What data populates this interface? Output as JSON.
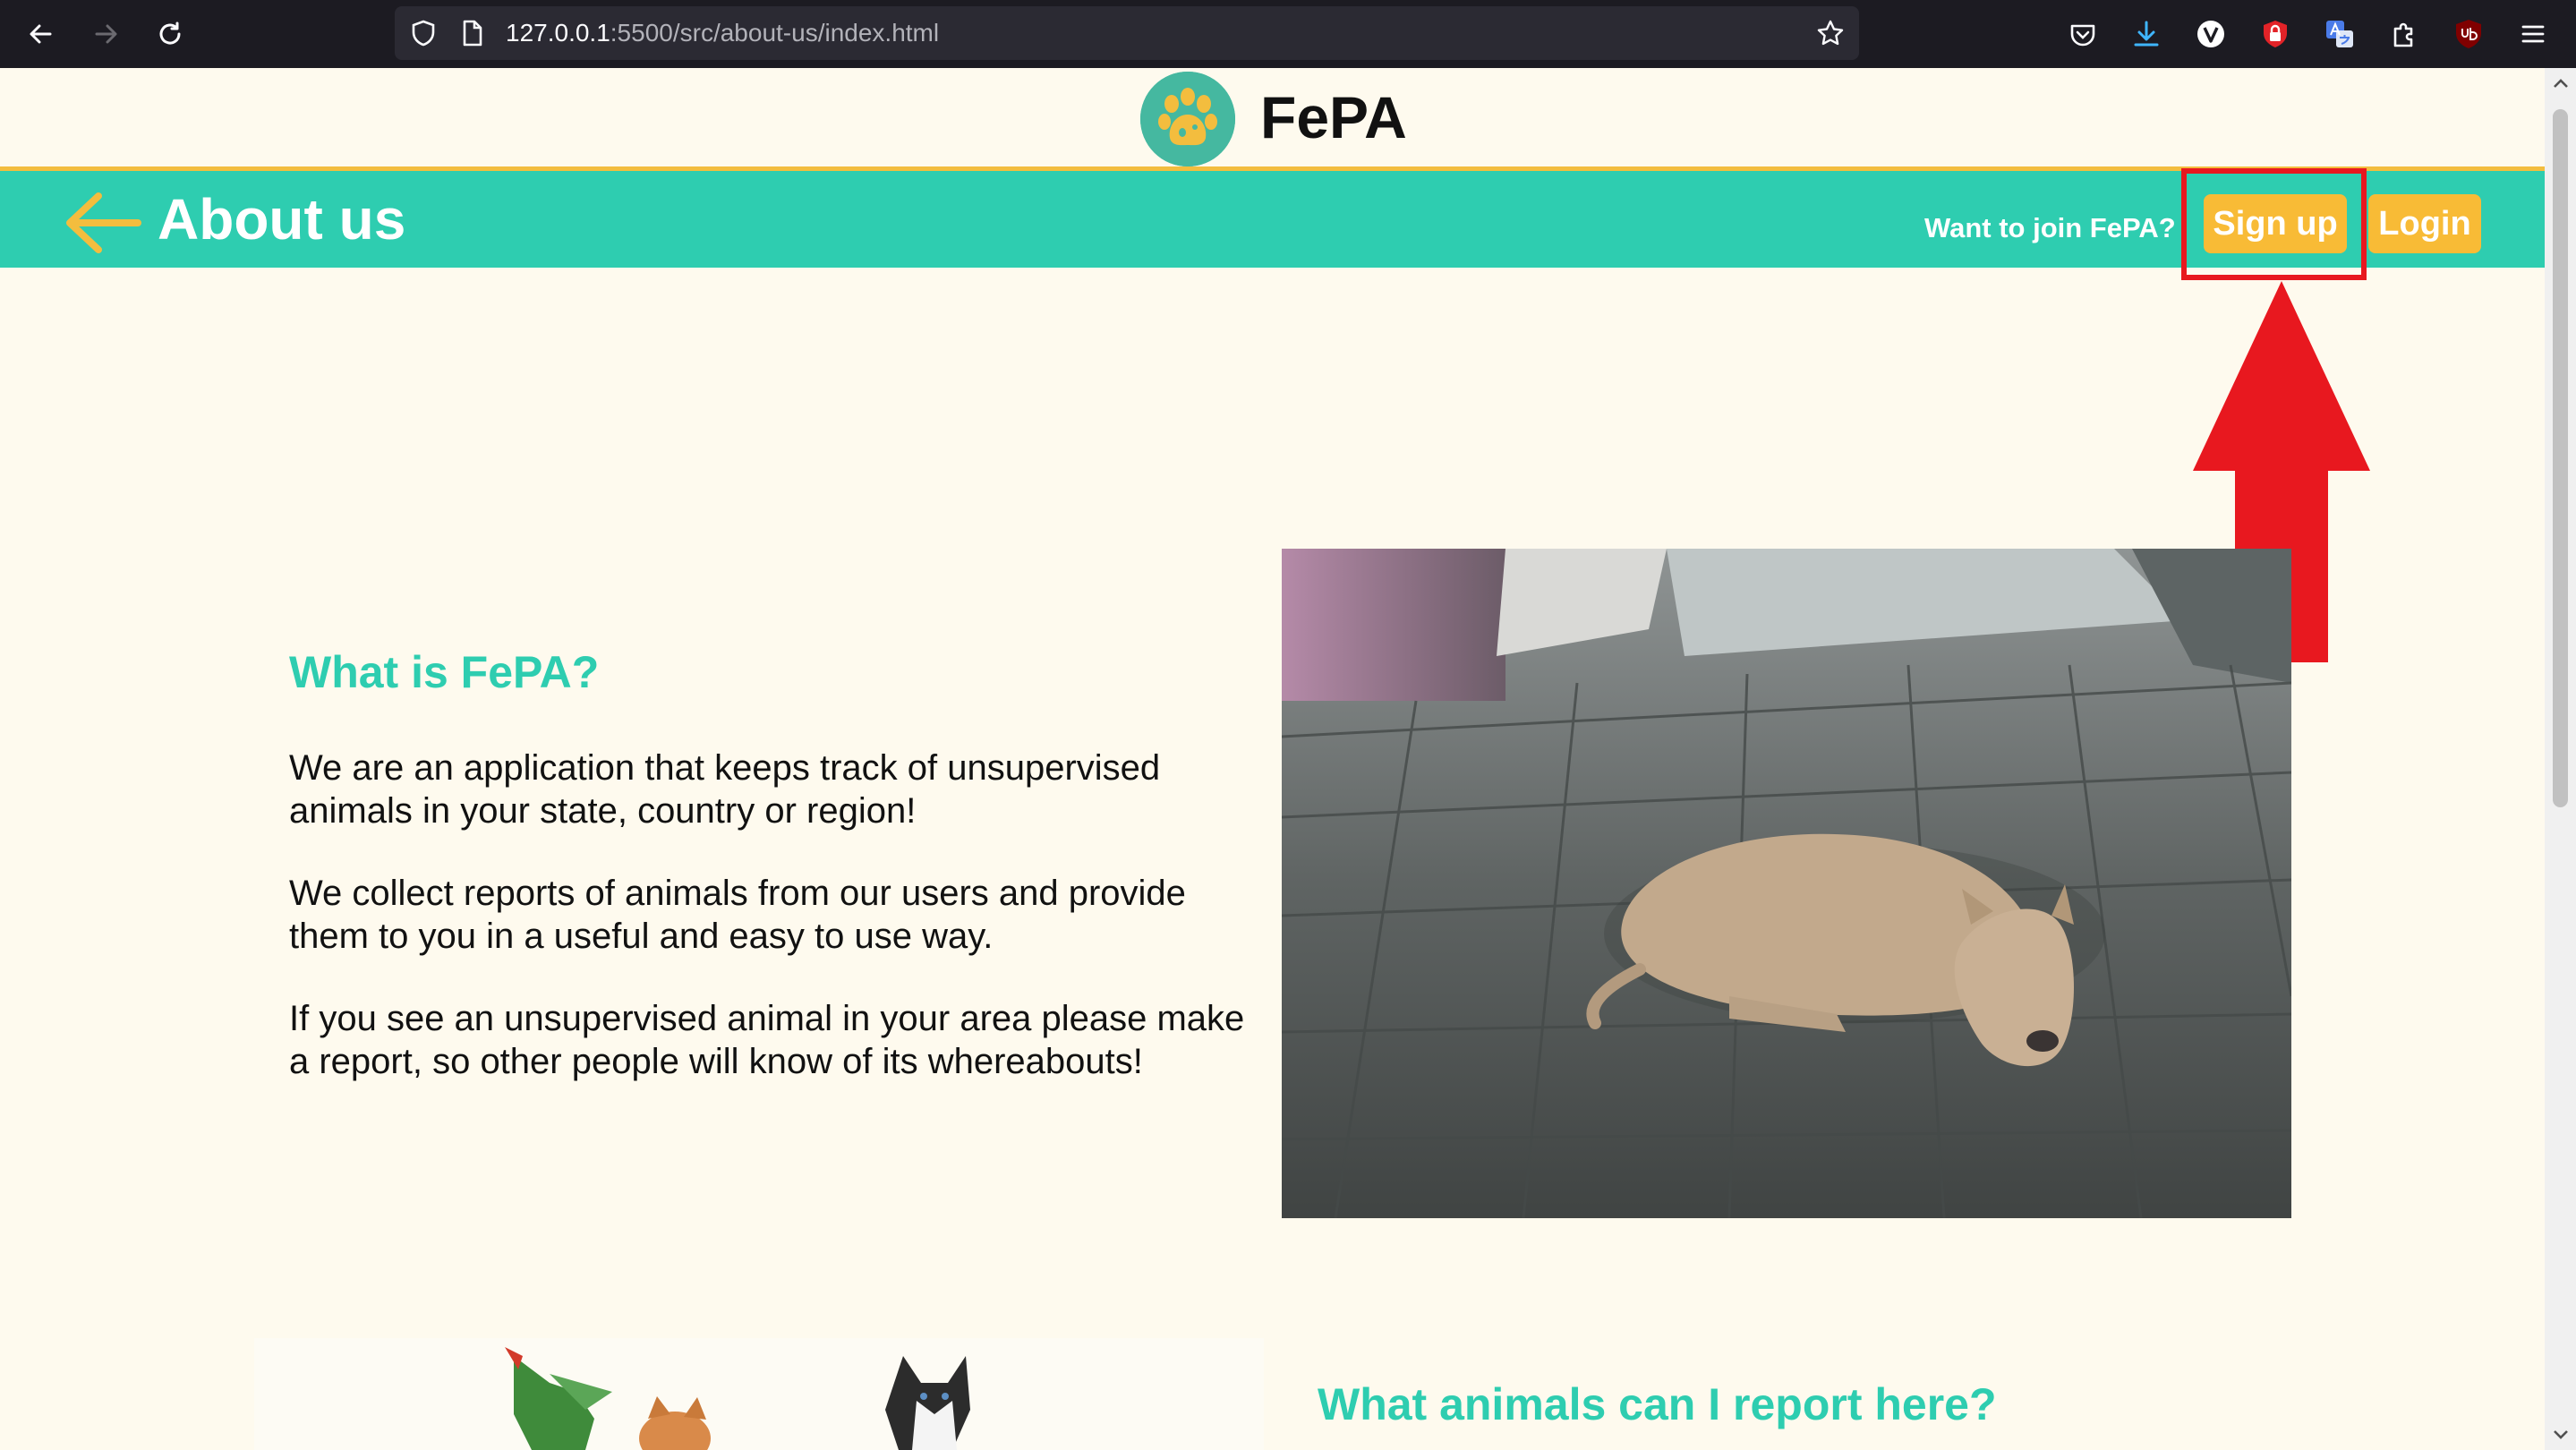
{
  "browser": {
    "url_host": "127.0.0.1",
    "url_path": ":5500/src/about-us/index.html"
  },
  "header": {
    "brand": "FePA"
  },
  "navbar": {
    "title": "About us",
    "join_prompt": "Want to join FePA?",
    "signup_label": "Sign up",
    "login_label": "Login"
  },
  "about": {
    "heading": "What is FePA?",
    "paragraphs": [
      "We are an application that keeps track of unsupervised animals in your state, country or region!",
      "We collect reports of animals from our users and provide them to you in a useful and easy to use way.",
      "If you see an unsupervised animal in your area please make a report, so other people will know of its whereabouts!"
    ]
  },
  "animals_section": {
    "heading": "What animals can I report here?"
  },
  "colors": {
    "teal": "#2ecdb0",
    "yellow": "#f8bb36",
    "background": "#fefaee",
    "annotation_red": "#e8181f"
  }
}
